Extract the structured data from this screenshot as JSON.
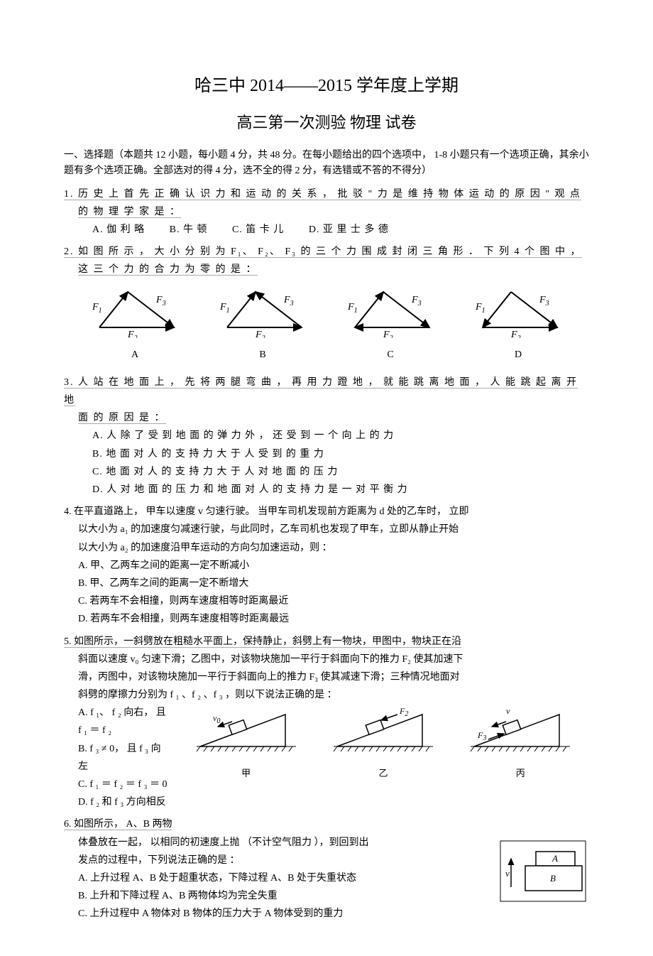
{
  "title1": "哈三中 2014——2015 学年度上学期",
  "title2": "高三第一次测验   物理 试卷",
  "instruction": "一、选择题（本题共   12 小题，每小题   4 分，共 48 分。在每小题给出的四个选项中，      1-8 小题只有一个选项正确，其余小题有多个选项正确。全部选对的得         4 分，选不全的得   2 分，有选错或不答的不得分）",
  "q1": {
    "stem": "1. 历 史 上 首 先 正 确 认 识 力 和 运 动 的 关 系 ， 批 驳 \" 力 是 维 持 物 体 运 动 的 原 因 \" 观 点",
    "stem2": "的 物 理 学 家 是 ：",
    "A": "A.  伽 利 略",
    "B": "B.  牛 顿",
    "C": "C.  笛 卡 儿",
    "D": "D.  亚 里 士 多 德"
  },
  "q2": {
    "stem": "2. 如 图 所 示 ， 大 小 分 别 为 F₁、 F₂、 F₃ 的 三 个 力 围 成 封 闭 三 角 形 ． 下 列 4 个 图 中 ，",
    "stem2": "这 三 个 力 的 合 力 为 零 的 是 ：",
    "labels": {
      "A": "A",
      "B": "B",
      "C": "C",
      "D": "D"
    }
  },
  "q3": {
    "stem": "3. 人 站 在 地 面 上 ， 先 将 两 腿 弯 曲 ， 再 用 力 蹬 地 ， 就 能 跳 离 地 面 ， 人 能 跳 起 离 开 地",
    "stem2": "面 的 原 因 是 ：",
    "A": "A.  人 除 了 受 到 地 面 的 弹 力 外 ， 还 受 到 一 个 向 上 的 力",
    "B": "B.  地 面 对 人 的 支 持 力 大 于 人 受 到 的 重 力",
    "C": "C.  地 面 对 人 的 支 持 力 大 于 人 对 地 面 的 压 力",
    "D": "D.  人 对 地 面 的 压 力 和 地 面 对 人 的 支 持 力 是 一 对 平 衡 力"
  },
  "q4": {
    "l1": "4. 在平直道路上，   甲车以速度   v 匀速行驶。  当甲车司机发现前方距离为    d 处的乙车时，  立即",
    "l2": "以大小为   a₁ 的加速度匀减速行驶，与此同时，乙车司机也发现了甲车，立即从静止开始",
    "l3": "以大小为   a₂ 的加速度沿甲车运动的方向匀加速运动，则    ：",
    "A": "A. 甲、乙两车之间的距离一定不断减小",
    "B": "B. 甲、乙两车之间的距离一定不断增大",
    "C": "C. 若两车不会相撞，则两车速度相等时距离最近",
    "D": "D. 若两车不会相撞，则两车速度相等时距离最远"
  },
  "q5": {
    "l1": "5. 如图所示，一斜劈放在粗糙水平面上，保持静止，斜劈上有一物块，甲图中，物块正在沿",
    "l2": "斜面以速度   v₀ 匀速下滑；乙图中，对该物块施加一平行于斜面向下的推力        F₂ 使其加速下",
    "l3": "滑，丙图中，对该物块施加一平行于斜面向上的推力       F₃ 使其减速下滑；三种情况地面对",
    "l4": "斜劈的摩擦力分别为    f ₁ 、f ₂ 、f ₃ ，则以下说法正确的是   ：",
    "A": "A.  f ₁、 f ₂ 向右， 且  f ₁ ＝ f ₂",
    "B": "B.  f ₃ ≠ 0， 且 f ₃ 向左",
    "C": "C.  f ₁ ＝ f ₂ ＝ f ₃ ＝ 0",
    "D": "D.  f ₂ 和 f ₃ 方向相反",
    "figs": {
      "jia": "甲",
      "yi": "乙",
      "bing": "丙"
    }
  },
  "q6": {
    "l1": "6. 如图所示，   A、B 两物",
    "l2": "体叠放在一起，   以相同的初速度上抛  （不计空气阻力  ），到回到出",
    "l3": "发点的过程中，下列说法正确的是    ：",
    "A": "A.  上升过程  A、B 处于超重状态，下降过程    A、B 处于失重状态",
    "B": "B.  上升和下降过程   A、B 两物体均为完全失重",
    "C": "C.  上升过程中   A 物体对 B 物体的压力大于   A 物体受到的重力",
    "boxA": "A",
    "boxB": "B",
    "arrow": "v"
  }
}
